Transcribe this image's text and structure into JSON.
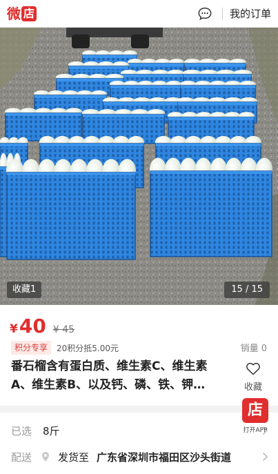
{
  "header": {
    "logo_prefix": "微",
    "logo_badge": "店",
    "orders_label": "我的订单",
    "chat_icon": "chat-bubble-icon"
  },
  "gallery": {
    "favorites_badge": "收藏1",
    "page_counter": "15 / 15"
  },
  "product": {
    "currency_symbol": "¥",
    "price": "40",
    "original_price": "¥ 45",
    "points_tag": "积分专享",
    "points_text": "20积分抵5.00元",
    "sales": "销量 0",
    "title": "番石榴含有蛋白质、维生素C、维生素A、维生素B、以及钙、磷、铁、钾…",
    "favorite_label": "收藏"
  },
  "options": {
    "selected_label": "已选",
    "selected_value": "8斤",
    "shipping_label": "配送",
    "shipping_prefix": "发货至",
    "shipping_address": "广东省深圳市福田区沙头街道"
  },
  "app_button": {
    "badge": "店",
    "label": "打开APP"
  },
  "colors": {
    "accent": "#e02e2e",
    "basket_blue": "#2f86e0"
  }
}
